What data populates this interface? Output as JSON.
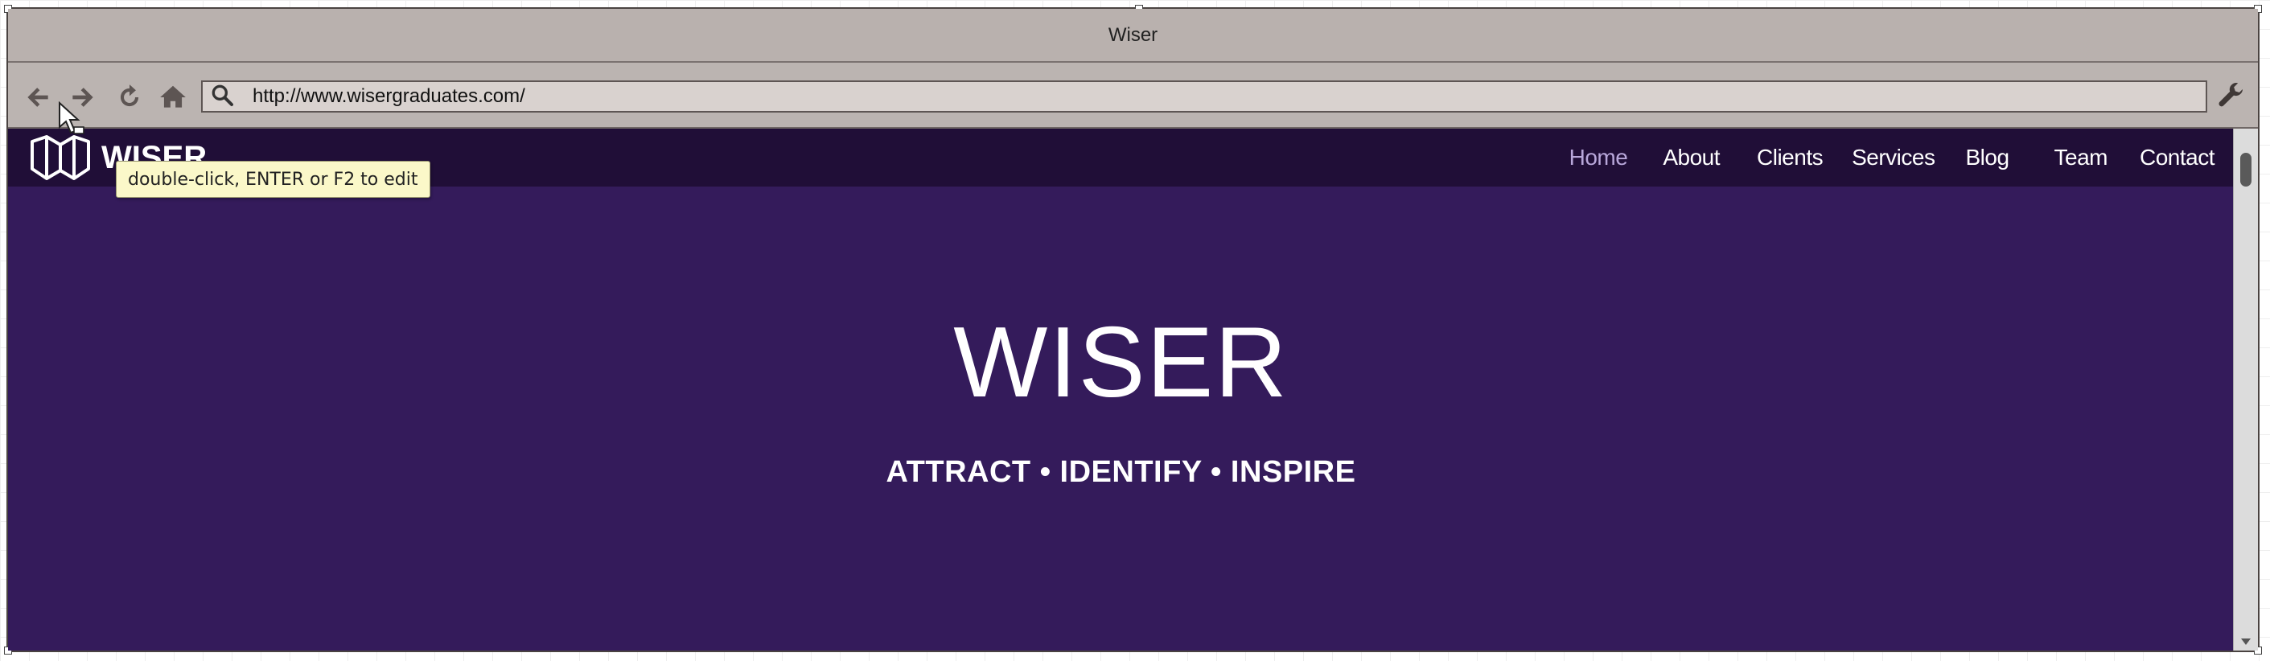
{
  "window": {
    "title": "Wiser"
  },
  "toolbar": {
    "back_icon": "arrow-left-icon",
    "forward_icon": "arrow-right-icon",
    "reload_icon": "reload-icon",
    "home_icon": "home-icon",
    "search_icon": "search-icon",
    "settings_icon": "wrench-icon",
    "url": "http://www.wisergraduates.com/"
  },
  "site": {
    "logo_text": "WISER",
    "nav": [
      {
        "label": "Home",
        "active": true
      },
      {
        "label": "About",
        "active": false
      },
      {
        "label": "Clients",
        "active": false
      },
      {
        "label": "Services",
        "active": false
      },
      {
        "label": "Blog",
        "active": false
      },
      {
        "label": "Team",
        "active": false
      },
      {
        "label": "Contact",
        "active": false
      }
    ],
    "hero_title": "WISER",
    "hero_subtitle": "ATTRACT • IDENTIFY • INSPIRE"
  },
  "tooltip": {
    "text": "double-click, ENTER or F2 to edit"
  },
  "colors": {
    "nav_bg": "#200e37",
    "hero_bg": "#341b5b",
    "active_nav": "#b8a7da",
    "chrome": "#b9b1ae"
  }
}
